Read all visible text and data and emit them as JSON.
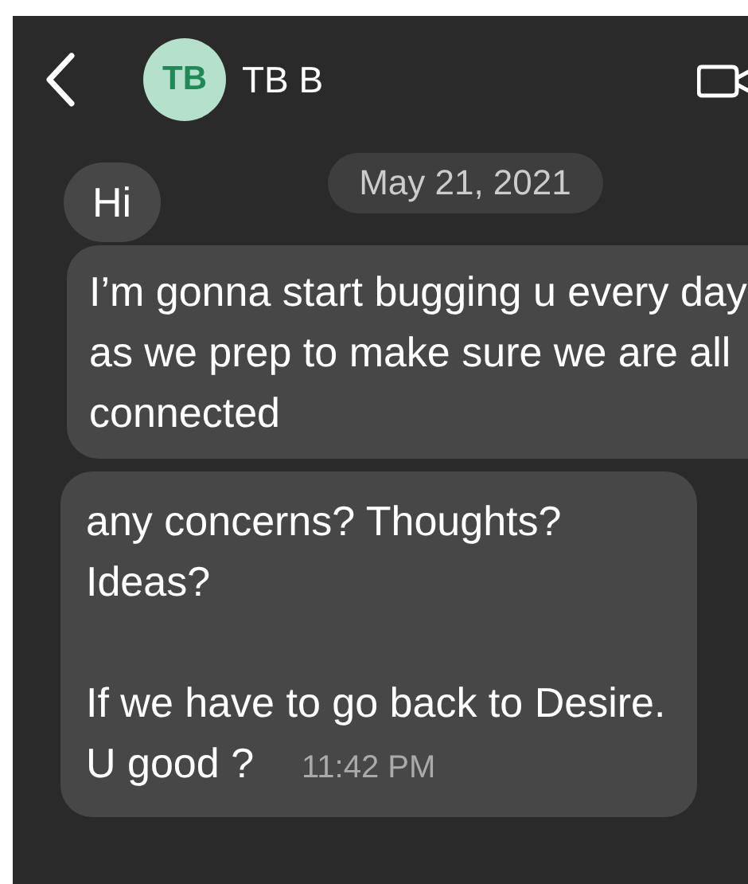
{
  "contact": {
    "initials": "TB",
    "name": "TB B"
  },
  "date": "May 21, 2021",
  "messages": [
    {
      "text": "Hi"
    },
    {
      "text": "I’m gonna start bugging u every day as we prep to make sure we are all connected"
    },
    {
      "text": "any concerns? Thoughts? Ideas?\n\nIf we have to go back to Desire. U good ?",
      "time": "11:42 PM"
    }
  ]
}
